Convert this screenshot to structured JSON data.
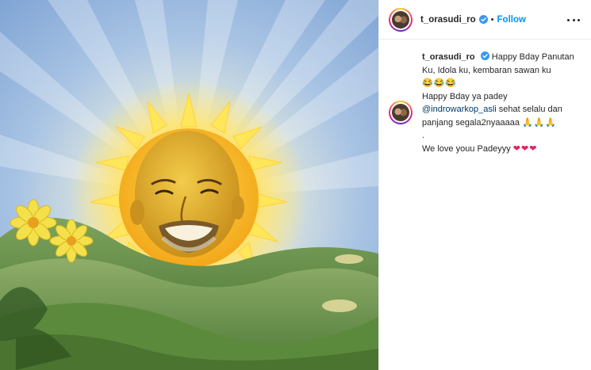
{
  "post": {
    "username": "t_orasudi_ro",
    "follow_label": "Follow",
    "separator": "•"
  },
  "caption": {
    "username": "t_orasudi_ro",
    "line1": "Happy Bday Panutan Ku, Idola ku, kembaran sawan ku",
    "line1_emoji": "😂😂😂",
    "line2": "Happy Bday ya padey",
    "mention": "@indrowarkop_asli",
    "line3": " sehat selalu dan panjang segala2nyaaaaa",
    "line3_emoji": "🙏🙏🙏",
    "dot": ".",
    "line4": "We love youu Padeyyy",
    "line4_emoji": "❤❤❤"
  },
  "colors": {
    "link": "#0095f6",
    "mention": "#00376b",
    "verified": "#3897f0",
    "heart": "#e0245e"
  },
  "icons": {
    "verified": "verified-badge-icon",
    "more": "more-options-icon"
  }
}
